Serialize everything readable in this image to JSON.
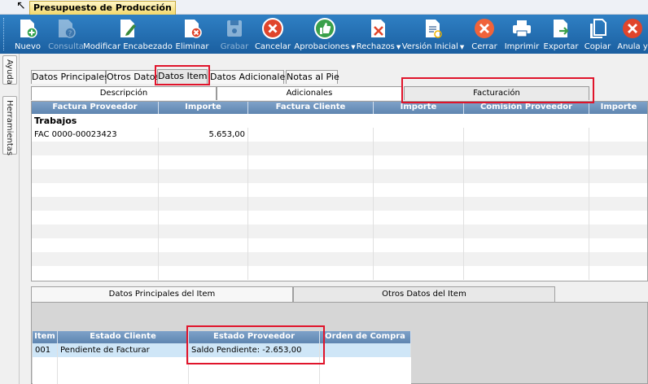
{
  "window": {
    "tab_title": "Presupuesto de Producción"
  },
  "toolbar": {
    "buttons": [
      {
        "label": "Nuevo",
        "icon": "new-doc-icon",
        "enabled": true
      },
      {
        "label": "Consulta",
        "icon": "query-doc-icon",
        "enabled": false
      },
      {
        "label": "Modificar Encabezado",
        "icon": "edit-pencil-icon",
        "enabled": true
      },
      {
        "label": "Eliminar",
        "icon": "delete-doc-icon",
        "enabled": true
      },
      {
        "label": "Grabar",
        "icon": "save-disk-icon",
        "enabled": false
      },
      {
        "label": "Cancelar",
        "icon": "cancel-circle-icon",
        "enabled": true
      },
      {
        "label": "Aprobaciones",
        "icon": "thumbs-up-icon",
        "enabled": true,
        "dropdown": true
      },
      {
        "label": "Rechazos",
        "icon": "reject-doc-icon",
        "enabled": true,
        "dropdown": true
      },
      {
        "label": "Versión Inicial",
        "icon": "version-doc-icon",
        "enabled": true,
        "dropdown": true
      },
      {
        "label": "Cerrar",
        "icon": "close-x-icon",
        "enabled": true
      },
      {
        "label": "Imprimir",
        "icon": "printer-icon",
        "enabled": true
      },
      {
        "label": "Exportar",
        "icon": "export-doc-icon",
        "enabled": true
      },
      {
        "label": "Copiar",
        "icon": "copy-doc-icon",
        "enabled": true
      },
      {
        "label": "Anula y",
        "icon": "annul-icon",
        "enabled": true
      }
    ]
  },
  "sidebar": {
    "tabs": [
      "Ayuda",
      "Herramientas"
    ]
  },
  "main_tabs": [
    "Datos Principales",
    "Otros Datos",
    "Datos Item",
    "Datos Adicionales",
    "Notas al Pie"
  ],
  "active_main_tab": "Datos Item",
  "sub_tabs": [
    "Descripción",
    "Adicionales",
    "Facturación"
  ],
  "active_sub_tab": "Facturación",
  "billing_grid": {
    "columns": [
      "Factura Proveedor",
      "Importe",
      "Factura Cliente",
      "Importe",
      "Comisión Proveedor",
      "Importe"
    ],
    "group_label": "Trabajos",
    "rows": [
      {
        "factura_proveedor": "FAC 0000-00023423",
        "importe": "5.653,00",
        "factura_cliente": "",
        "importe2": "",
        "comision": "",
        "importe3": ""
      }
    ]
  },
  "bottom_tabs": [
    "Datos Principales del Item",
    "Otros Datos del Item"
  ],
  "active_bottom_tab": "Otros Datos del Item",
  "item_grid": {
    "columns": [
      "Item",
      "Estado Cliente",
      "Estado Proveedor",
      "Orden de Compra"
    ],
    "rows": [
      {
        "item": "001",
        "estado_cliente": "Pendiente de Facturar",
        "estado_proveedor": "Saldo Pendiente: -2.653,00",
        "orden_compra": ""
      }
    ]
  },
  "colors": {
    "toolbar": "#2f80c4",
    "grid_header": "#6f94bd",
    "highlight": "#e0142b",
    "selected_row": "#cfe6f7"
  }
}
